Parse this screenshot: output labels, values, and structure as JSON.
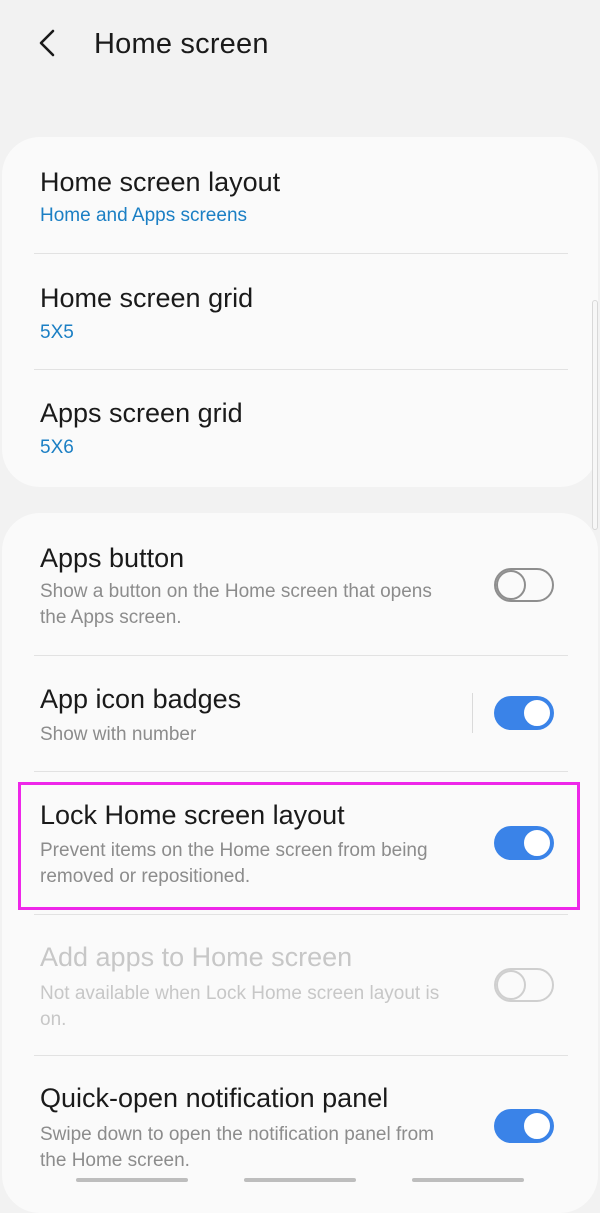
{
  "header": {
    "title": "Home screen",
    "back_icon": "chevron-left-icon"
  },
  "layout_card": {
    "items": [
      {
        "title": "Home screen layout",
        "value": "Home and Apps screens"
      },
      {
        "title": "Home screen grid",
        "value": "5X5"
      },
      {
        "title": "Apps screen grid",
        "value": "5X6"
      }
    ]
  },
  "settings_card": {
    "items": [
      {
        "title": "Apps button",
        "description": "Show a button on the Home screen that opens the Apps screen.",
        "toggle": "off",
        "enabled": true
      },
      {
        "title": "App icon badges",
        "description": "Show with number",
        "toggle": "on",
        "enabled": true
      },
      {
        "title": "Lock Home screen layout",
        "description": "Prevent items on the Home screen from being removed or repositioned.",
        "toggle": "on",
        "enabled": true,
        "highlighted": true
      },
      {
        "title": "Add apps to Home screen",
        "description": "Not available when Lock Home screen layout is on.",
        "toggle": "off",
        "enabled": false
      },
      {
        "title": "Quick-open notification panel",
        "description": "Swipe down to open the notification panel from the Home screen.",
        "toggle": "on",
        "enabled": true
      }
    ]
  },
  "colors": {
    "accent": "#3a83e8",
    "link": "#1b7fc4",
    "highlight": "#ee27e9",
    "background": "#f2f2f2",
    "card": "#fafafa"
  }
}
